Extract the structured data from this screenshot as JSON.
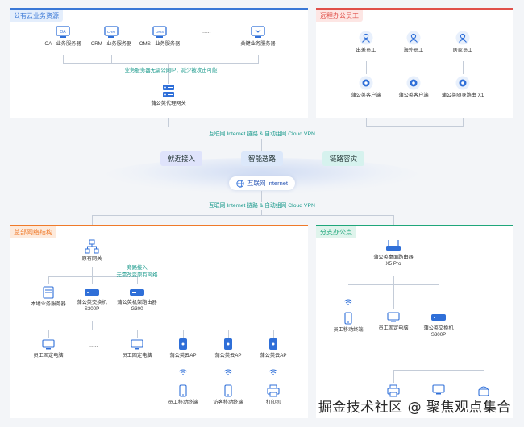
{
  "cloud_panel": {
    "title": "公有云业务资源",
    "servers": [
      {
        "label": "OA · 业务服务器",
        "badge": "OA"
      },
      {
        "label": "CRM · 业务服务器",
        "badge": "CRM"
      },
      {
        "label": "OMS · 业务服务器",
        "badge": "OMS"
      },
      {
        "label": "关键业务服务器",
        "badge": ""
      }
    ],
    "ellipsis": "......",
    "note": "业务服务器无需公网IP，减少被攻击可能",
    "gateway": "蒲公英代理网关"
  },
  "remote_panel": {
    "title": "远程办公员工",
    "people": [
      "出差员工",
      "海外员工",
      "居家员工"
    ],
    "clients": [
      "蒲公英客户端",
      "蒲公英客户端",
      "蒲公英随身路由 X1"
    ]
  },
  "middle": {
    "link_top": "互联网 Internet 链路 & 自动组网 Cloud VPN",
    "pills": [
      "就近接入",
      "智能选路",
      "链路容灾"
    ],
    "internet": "互联网 Internet",
    "link_bottom": "互联网 Internet 链路 & 自动组网 Cloud VPN"
  },
  "hq_panel": {
    "title": "总部网络结构",
    "original_gateway": "原有网关",
    "bypass_note_1": "旁路接入",
    "bypass_note_2": "无需改变原有网络",
    "local_server": "本地业务服务器",
    "switch_label": "蒲公英交换机",
    "switch_model": "S300P",
    "router_label": "蒲公英机架路由器",
    "router_model": "G300",
    "pc1": "员工固定电脑",
    "ellipsis": "......",
    "pc2": "员工固定电脑",
    "ap": "蒲公英云AP",
    "mobile": "员工移动终端",
    "visitor": "访客移动终端",
    "printer": "打印机"
  },
  "branch_panel": {
    "title": "分支办公点",
    "router_label": "蒲公英桌面路由器",
    "router_model": "X5 Pro",
    "mobile": "员工移动终端",
    "pc": "员工固定电脑",
    "switch_label": "蒲公英交换机",
    "switch_model": "S300P"
  },
  "watermark": "掘金技术社区 @ 聚焦观点集合",
  "colors": {
    "cloud": "#3a78d6",
    "remote": "#e0504a",
    "hq": "#ef7a2a",
    "branch": "#1fa67a",
    "icon": "#2f6fd8",
    "note": "#1a9a8c"
  }
}
